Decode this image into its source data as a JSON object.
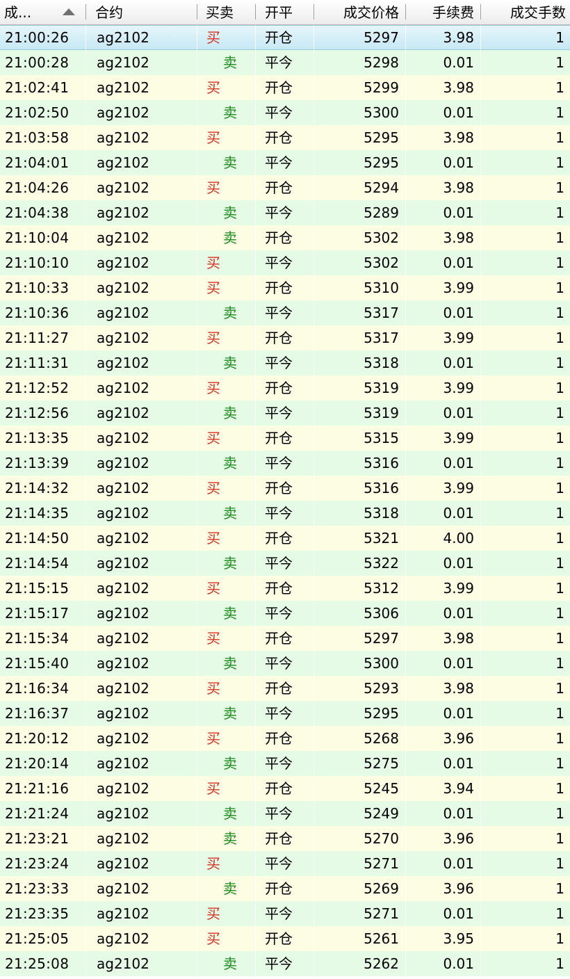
{
  "header": {
    "time": "成...",
    "contract": "合约",
    "side": "买卖",
    "open_close": "开平",
    "price": "成交价格",
    "fee": "手续费",
    "qty": "成交手数"
  },
  "colors": {
    "buy": "#d83020",
    "sell": "#1a8a1a",
    "row_odd": "#fdfde4",
    "row_even": "#e5fbe5",
    "row_selected": "#c6e8f4"
  },
  "rows": [
    {
      "time": "21:00:26",
      "contract": "ag2102",
      "side": "买",
      "oc": "开仓",
      "price": "5297",
      "fee": "3.98",
      "qty": "1"
    },
    {
      "time": "21:00:28",
      "contract": "ag2102",
      "side": "卖",
      "oc": "平今",
      "price": "5298",
      "fee": "0.01",
      "qty": "1"
    },
    {
      "time": "21:02:41",
      "contract": "ag2102",
      "side": "买",
      "oc": "开仓",
      "price": "5299",
      "fee": "3.98",
      "qty": "1"
    },
    {
      "time": "21:02:50",
      "contract": "ag2102",
      "side": "卖",
      "oc": "平今",
      "price": "5300",
      "fee": "0.01",
      "qty": "1"
    },
    {
      "time": "21:03:58",
      "contract": "ag2102",
      "side": "买",
      "oc": "开仓",
      "price": "5295",
      "fee": "3.98",
      "qty": "1"
    },
    {
      "time": "21:04:01",
      "contract": "ag2102",
      "side": "卖",
      "oc": "平今",
      "price": "5295",
      "fee": "0.01",
      "qty": "1"
    },
    {
      "time": "21:04:26",
      "contract": "ag2102",
      "side": "买",
      "oc": "开仓",
      "price": "5294",
      "fee": "3.98",
      "qty": "1"
    },
    {
      "time": "21:04:38",
      "contract": "ag2102",
      "side": "卖",
      "oc": "平今",
      "price": "5289",
      "fee": "0.01",
      "qty": "1"
    },
    {
      "time": "21:10:04",
      "contract": "ag2102",
      "side": "卖",
      "oc": "开仓",
      "price": "5302",
      "fee": "3.98",
      "qty": "1"
    },
    {
      "time": "21:10:10",
      "contract": "ag2102",
      "side": "买",
      "oc": "平今",
      "price": "5302",
      "fee": "0.01",
      "qty": "1"
    },
    {
      "time": "21:10:33",
      "contract": "ag2102",
      "side": "买",
      "oc": "开仓",
      "price": "5310",
      "fee": "3.99",
      "qty": "1"
    },
    {
      "time": "21:10:36",
      "contract": "ag2102",
      "side": "卖",
      "oc": "平今",
      "price": "5317",
      "fee": "0.01",
      "qty": "1"
    },
    {
      "time": "21:11:27",
      "contract": "ag2102",
      "side": "买",
      "oc": "开仓",
      "price": "5317",
      "fee": "3.99",
      "qty": "1"
    },
    {
      "time": "21:11:31",
      "contract": "ag2102",
      "side": "卖",
      "oc": "平今",
      "price": "5318",
      "fee": "0.01",
      "qty": "1"
    },
    {
      "time": "21:12:52",
      "contract": "ag2102",
      "side": "买",
      "oc": "开仓",
      "price": "5319",
      "fee": "3.99",
      "qty": "1"
    },
    {
      "time": "21:12:56",
      "contract": "ag2102",
      "side": "卖",
      "oc": "平今",
      "price": "5319",
      "fee": "0.01",
      "qty": "1"
    },
    {
      "time": "21:13:35",
      "contract": "ag2102",
      "side": "买",
      "oc": "开仓",
      "price": "5315",
      "fee": "3.99",
      "qty": "1"
    },
    {
      "time": "21:13:39",
      "contract": "ag2102",
      "side": "卖",
      "oc": "平今",
      "price": "5316",
      "fee": "0.01",
      "qty": "1"
    },
    {
      "time": "21:14:32",
      "contract": "ag2102",
      "side": "买",
      "oc": "开仓",
      "price": "5316",
      "fee": "3.99",
      "qty": "1"
    },
    {
      "time": "21:14:35",
      "contract": "ag2102",
      "side": "卖",
      "oc": "平今",
      "price": "5318",
      "fee": "0.01",
      "qty": "1"
    },
    {
      "time": "21:14:50",
      "contract": "ag2102",
      "side": "买",
      "oc": "开仓",
      "price": "5321",
      "fee": "4.00",
      "qty": "1"
    },
    {
      "time": "21:14:54",
      "contract": "ag2102",
      "side": "卖",
      "oc": "平今",
      "price": "5322",
      "fee": "0.01",
      "qty": "1"
    },
    {
      "time": "21:15:15",
      "contract": "ag2102",
      "side": "买",
      "oc": "开仓",
      "price": "5312",
      "fee": "3.99",
      "qty": "1"
    },
    {
      "time": "21:15:17",
      "contract": "ag2102",
      "side": "卖",
      "oc": "平今",
      "price": "5306",
      "fee": "0.01",
      "qty": "1"
    },
    {
      "time": "21:15:34",
      "contract": "ag2102",
      "side": "买",
      "oc": "开仓",
      "price": "5297",
      "fee": "3.98",
      "qty": "1"
    },
    {
      "time": "21:15:40",
      "contract": "ag2102",
      "side": "卖",
      "oc": "平今",
      "price": "5300",
      "fee": "0.01",
      "qty": "1"
    },
    {
      "time": "21:16:34",
      "contract": "ag2102",
      "side": "买",
      "oc": "开仓",
      "price": "5293",
      "fee": "3.98",
      "qty": "1"
    },
    {
      "time": "21:16:37",
      "contract": "ag2102",
      "side": "卖",
      "oc": "平今",
      "price": "5295",
      "fee": "0.01",
      "qty": "1"
    },
    {
      "time": "21:20:12",
      "contract": "ag2102",
      "side": "买",
      "oc": "开仓",
      "price": "5268",
      "fee": "3.96",
      "qty": "1"
    },
    {
      "time": "21:20:14",
      "contract": "ag2102",
      "side": "卖",
      "oc": "平今",
      "price": "5275",
      "fee": "0.01",
      "qty": "1"
    },
    {
      "time": "21:21:16",
      "contract": "ag2102",
      "side": "买",
      "oc": "开仓",
      "price": "5245",
      "fee": "3.94",
      "qty": "1"
    },
    {
      "time": "21:21:24",
      "contract": "ag2102",
      "side": "卖",
      "oc": "平今",
      "price": "5249",
      "fee": "0.01",
      "qty": "1"
    },
    {
      "time": "21:23:21",
      "contract": "ag2102",
      "side": "卖",
      "oc": "开仓",
      "price": "5270",
      "fee": "3.96",
      "qty": "1"
    },
    {
      "time": "21:23:24",
      "contract": "ag2102",
      "side": "买",
      "oc": "平今",
      "price": "5271",
      "fee": "0.01",
      "qty": "1"
    },
    {
      "time": "21:23:33",
      "contract": "ag2102",
      "side": "卖",
      "oc": "开仓",
      "price": "5269",
      "fee": "3.96",
      "qty": "1"
    },
    {
      "time": "21:23:35",
      "contract": "ag2102",
      "side": "买",
      "oc": "平今",
      "price": "5271",
      "fee": "0.01",
      "qty": "1"
    },
    {
      "time": "21:25:05",
      "contract": "ag2102",
      "side": "买",
      "oc": "开仓",
      "price": "5261",
      "fee": "3.95",
      "qty": "1"
    },
    {
      "time": "21:25:08",
      "contract": "ag2102",
      "side": "卖",
      "oc": "平今",
      "price": "5262",
      "fee": "0.01",
      "qty": "1"
    }
  ]
}
